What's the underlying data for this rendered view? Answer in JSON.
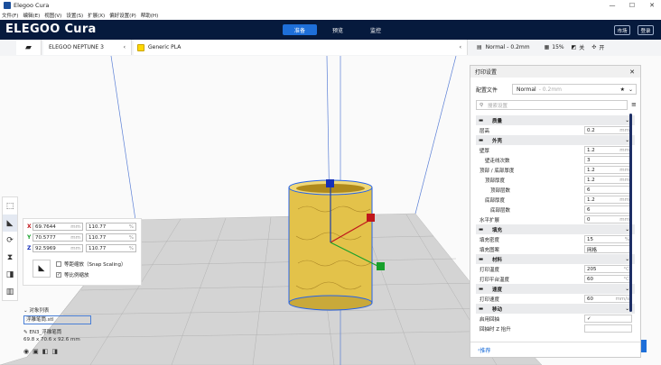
{
  "window": {
    "title": "Elegoo Cura",
    "minimize": "—",
    "maximize": "☐",
    "close": "✕"
  },
  "menu": [
    "文件(F)",
    "编辑(E)",
    "视图(V)",
    "设置(S)",
    "扩展(X)",
    "偏好设置(P)",
    "帮助(H)"
  ],
  "header": {
    "logo": "ELEGOO Cura",
    "stages": [
      {
        "label": "准备",
        "active": true
      },
      {
        "label": "预览",
        "active": false
      },
      {
        "label": "监控",
        "active": false
      }
    ],
    "market_label": "市场",
    "login_label": "登录"
  },
  "toolbar": {
    "printer": "ELEGOO NEPTUNE 3",
    "material": "Generic PLA",
    "profile": "Normal - 0.2mm",
    "infill": "15%",
    "support": "关",
    "adhesion": "开"
  },
  "scale": {
    "x_mm": "69.7644",
    "x_pct": "110.77",
    "y_mm": "70.5777",
    "y_pct": "110.77",
    "z_mm": "92.5969",
    "z_pct": "110.77",
    "mm_unit": "mm",
    "pct_unit": "%",
    "snap_label": "等距缩放（Snap Scaling）",
    "uniform_label": "等比例缩放",
    "uniform_checked": "✓"
  },
  "objects": {
    "header": "对象列表",
    "filename": "浮雕笔筒.stl",
    "job_name": "EN3_浮雕笔筒",
    "dims": "69.8 x 70.6 x 92.6 mm"
  },
  "settings": {
    "title": "打印设置",
    "profile_label": "配置文件",
    "profile_value": "Normal",
    "profile_suffix": "- 0.2mm",
    "search_placeholder": "搜索设置",
    "rows": [
      {
        "type": "cat",
        "label": "质量"
      },
      {
        "label": "层高",
        "value": "0.2",
        "unit": "mm",
        "indent": 0
      },
      {
        "type": "cat",
        "label": "外壳"
      },
      {
        "label": "壁厚",
        "value": "1.2",
        "unit": "mm",
        "indent": 0
      },
      {
        "label": "壁走线次数",
        "value": "3",
        "unit": "",
        "indent": 1
      },
      {
        "label": "顶部 / 底部厚度",
        "value": "1.2",
        "unit": "mm",
        "indent": 0
      },
      {
        "label": "顶部厚度",
        "value": "1.2",
        "unit": "mm",
        "indent": 1
      },
      {
        "label": "顶部层数",
        "value": "6",
        "unit": "",
        "indent": 2
      },
      {
        "label": "底部厚度",
        "value": "1.2",
        "unit": "mm",
        "indent": 1
      },
      {
        "label": "底部层数",
        "value": "6",
        "unit": "",
        "indent": 2
      },
      {
        "label": "水平扩展",
        "value": "0",
        "unit": "mm",
        "indent": 0
      },
      {
        "type": "cat",
        "label": "填充"
      },
      {
        "label": "填充密度",
        "value": "15",
        "unit": "%",
        "indent": 0
      },
      {
        "label": "填充图案",
        "value": "网格",
        "unit": "",
        "indent": 0
      },
      {
        "type": "cat",
        "label": "材料"
      },
      {
        "label": "打印温度",
        "value": "205",
        "unit": "°C",
        "indent": 0
      },
      {
        "label": "打印平台温度",
        "value": "60",
        "unit": "°C",
        "indent": 0
      },
      {
        "type": "cat",
        "label": "速度"
      },
      {
        "label": "打印速度",
        "value": "60",
        "unit": "mm/s",
        "indent": 0
      },
      {
        "type": "cat",
        "label": "移动"
      },
      {
        "label": "启用回抽",
        "value": "✓",
        "unit": "",
        "indent": 0
      },
      {
        "label": "回抽时 Z 抬升",
        "value": "",
        "unit": "",
        "indent": 0
      }
    ],
    "recommended": "推荐"
  },
  "colors": {
    "header_bg": "#061a3d",
    "accent": "#1e6fd9",
    "model": "#e3c24a",
    "plate": "#c9c9c9"
  }
}
